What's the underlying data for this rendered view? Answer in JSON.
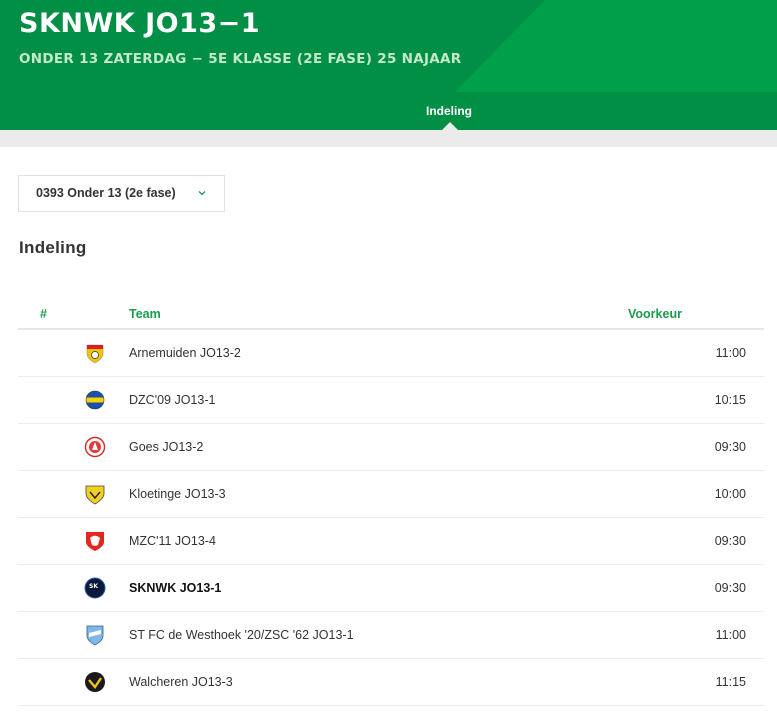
{
  "header": {
    "title": "SKNWK JO13−1",
    "subtitle": "ONDER 13 ZATERDAG − 5E KLASSE (2E FASE) 25 NAJAAR"
  },
  "tabs": [
    {
      "label": "Indeling",
      "active": true
    }
  ],
  "filter": {
    "selected": "0393 Onder 13 (2e fase)",
    "chevron_icon": "chevron-down-icon"
  },
  "section": {
    "title": "Indeling"
  },
  "table": {
    "headers": {
      "number": "#",
      "team": "Team",
      "preference": "Voorkeur"
    },
    "rows": [
      {
        "team": "Arnemuiden JO13-2",
        "time": "11:00",
        "logo": "shield-icon-arnemuiden"
      },
      {
        "team": "DZC'09 JO13-1",
        "time": "10:15",
        "logo": "crest-icon-dzc09"
      },
      {
        "team": "Goes JO13-2",
        "time": "09:30",
        "logo": "crest-icon-goes"
      },
      {
        "team": "Kloetinge JO13-3",
        "time": "10:00",
        "logo": "crest-icon-kloetinge"
      },
      {
        "team": "MZC'11 JO13-4",
        "time": "09:30",
        "logo": "crest-icon-mzc11"
      },
      {
        "team": "SKNWK JO13-1",
        "time": "09:30",
        "logo": "crest-icon-sknwk",
        "highlight": true
      },
      {
        "team": "ST FC de Westhoek '20/ZSC '62 JO13-1",
        "time": "11:00",
        "logo": "crest-icon-westhoek"
      },
      {
        "team": "Walcheren JO13-3",
        "time": "11:15",
        "logo": "crest-icon-walcheren"
      }
    ]
  },
  "colors": {
    "brand_green": "#008f45",
    "brand_green_light": "#00a04a",
    "header_accent_green": "#1d9a4c",
    "subtitle_green": "#c4e9ca",
    "band_grey": "#ebebeb"
  }
}
